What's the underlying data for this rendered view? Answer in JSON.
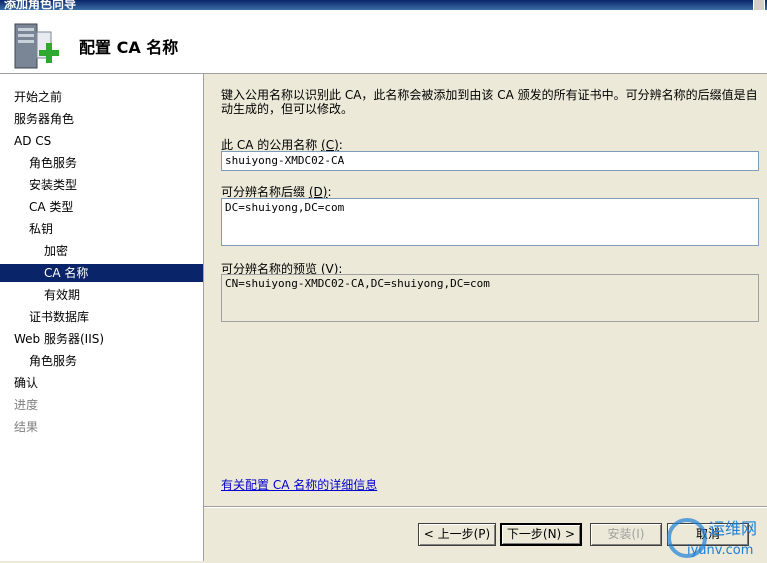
{
  "window": {
    "title": "添加角色向导"
  },
  "header": {
    "title": "配置 CA 名称",
    "icon": "server-add-icon"
  },
  "sidebar": {
    "items": [
      {
        "label": "开始之前",
        "level": 0,
        "state": "normal"
      },
      {
        "label": "服务器角色",
        "level": 0,
        "state": "normal"
      },
      {
        "label": "AD CS",
        "level": 0,
        "state": "normal"
      },
      {
        "label": "角色服务",
        "level": 1,
        "state": "normal"
      },
      {
        "label": "安装类型",
        "level": 1,
        "state": "normal"
      },
      {
        "label": "CA 类型",
        "level": 1,
        "state": "normal"
      },
      {
        "label": "私钥",
        "level": 1,
        "state": "normal"
      },
      {
        "label": "加密",
        "level": 2,
        "state": "normal"
      },
      {
        "label": "CA 名称",
        "level": 2,
        "state": "selected"
      },
      {
        "label": "有效期",
        "level": 2,
        "state": "normal"
      },
      {
        "label": "证书数据库",
        "level": 1,
        "state": "normal"
      },
      {
        "label": "Web 服务器(IIS)",
        "level": 0,
        "state": "normal"
      },
      {
        "label": "角色服务",
        "level": 1,
        "state": "normal"
      },
      {
        "label": "确认",
        "level": 0,
        "state": "normal"
      },
      {
        "label": "进度",
        "level": 0,
        "state": "disabled"
      },
      {
        "label": "结果",
        "level": 0,
        "state": "disabled"
      }
    ]
  },
  "main": {
    "description": "键入公用名称以识别此 CA，此名称会被添加到由该 CA 颁发的所有证书中。可分辨名称的后缀值是自动生成的，但可以修改。",
    "common_name": {
      "label": "此 CA 的公用名称",
      "accel": "(C)",
      "suffix": ":",
      "value": "shuiyong-XMDC02-CA"
    },
    "dn_suffix": {
      "label": "可分辨名称后缀",
      "accel": "(D)",
      "suffix": ":",
      "value": "DC=shuiyong,DC=com"
    },
    "preview": {
      "label": "可分辨名称的预览",
      "accel": "(V)",
      "suffix": ":",
      "value": "CN=shuiyong-XMDC02-CA,DC=shuiyong,DC=com"
    },
    "help_link": "有关配置 CA 名称的详细信息"
  },
  "footer": {
    "prev": "< 上一步(P)",
    "next": "下一步(N) >",
    "install": "安装(I)",
    "cancel": "取消"
  },
  "watermark": {
    "text": "运维网",
    "url_text": "iyunv.com"
  }
}
